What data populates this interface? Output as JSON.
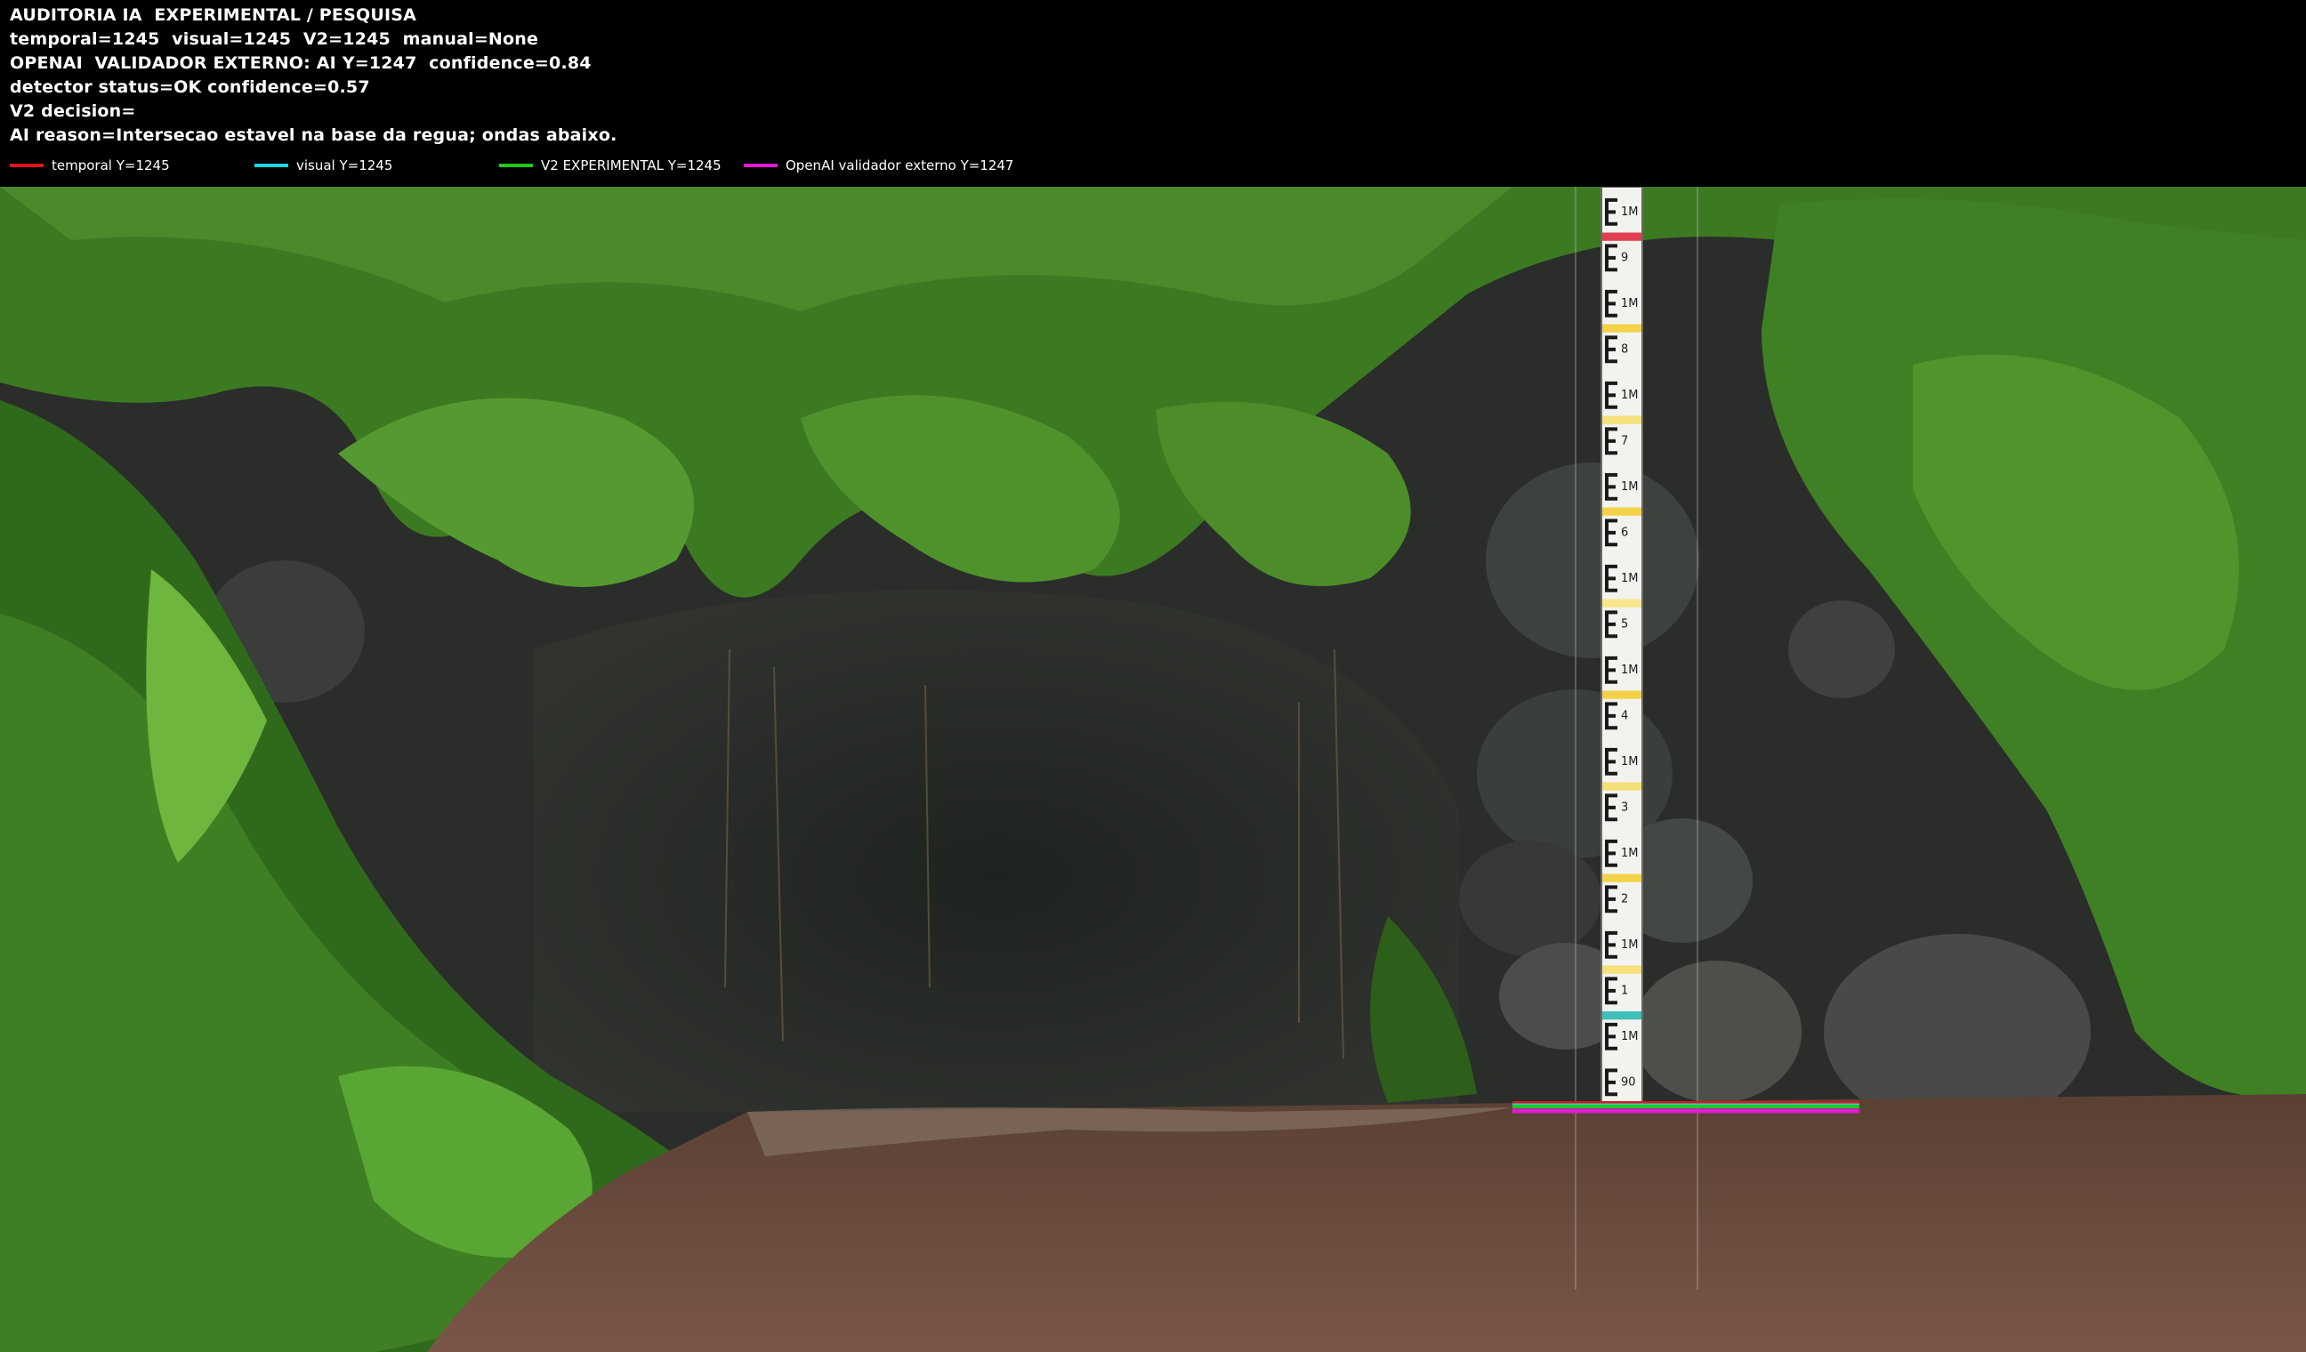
{
  "overlay": {
    "lines": [
      "AUDITORIA IA  EXPERIMENTAL / PESQUISA",
      "temporal=1245  visual=1245  V2=1245  manual=None",
      "OPENAI  VALIDADOR EXTERNO: AI Y=1247  confidence=0.84",
      "detector status=OK confidence=0.57",
      "V2 decision=",
      "AI reason=Intersecao estavel na base da regua; ondas abaixo."
    ],
    "legend": [
      {
        "label": "temporal Y=1245",
        "color": "#e0141a"
      },
      {
        "label": "visual Y=1245",
        "color": "#1ad6e6"
      },
      {
        "label": "V2 EXPERIMENTAL Y=1245",
        "color": "#22c81e"
      },
      {
        "label": "OpenAI validador externo Y=1247",
        "color": "#e21ad2"
      }
    ]
  },
  "gauge": {
    "labels": [
      "1M",
      "9",
      "1M",
      "8",
      "1M",
      "7",
      "1M",
      "6",
      "1M",
      "5",
      "1M",
      "4",
      "1M",
      "3",
      "1M",
      "2",
      "1M",
      "1",
      "1M",
      "90"
    ],
    "colors": {
      "vegetation": "#2f6a1c",
      "water": "#6a4a3a",
      "rock": "#2b2d2a"
    }
  }
}
